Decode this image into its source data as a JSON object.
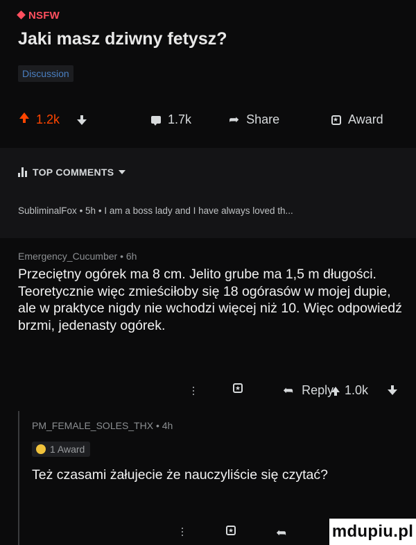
{
  "post": {
    "nsfw_label": "NSFW",
    "title": "Jaki masz dziwny fetysz?",
    "flair": "Discussion",
    "votes": "1.2k",
    "comments_count": "1.7k",
    "share_label": "Share",
    "award_label": "Award",
    "colors": {
      "upvote": "#ff4500",
      "nsfw": "#ff4f5e",
      "flair_text": "#4a7fc1"
    }
  },
  "comments_header": {
    "sort_label": "TOP COMMENTS"
  },
  "collapsed_comment": {
    "author": "SubliminalFox",
    "age": "5h",
    "preview": "I am a boss lady and I have always loved th..."
  },
  "comment1": {
    "author": "Emergency_Cucumber",
    "age": "6h",
    "body": "Przeciętny ogórek ma 8 cm. Jelito grube ma 1,5 m długości. Teoretycznie więc zmieściłoby się 18 ogórasów w mojej dupie, ale w praktyce nigdy nie wchodzi więcej niż 10. Więc odpowiedź brzmi, jedenasty ogórek.",
    "reply_label": "Reply",
    "votes": "1.0k"
  },
  "comment2": {
    "author": "PM_FEMALE_SOLES_THX",
    "age": "4h",
    "award_count_label": "1 Award",
    "body": "Też czasami żałujecie że nauczyliście się czytać?"
  },
  "watermark": {
    "text": "mdupiu.pl"
  },
  "icons": [
    "upvote-icon",
    "downvote-icon",
    "comment-icon",
    "share-icon",
    "award-icon",
    "top-comments-icon",
    "reply-icon",
    "more-icon",
    "medal-icon"
  ]
}
